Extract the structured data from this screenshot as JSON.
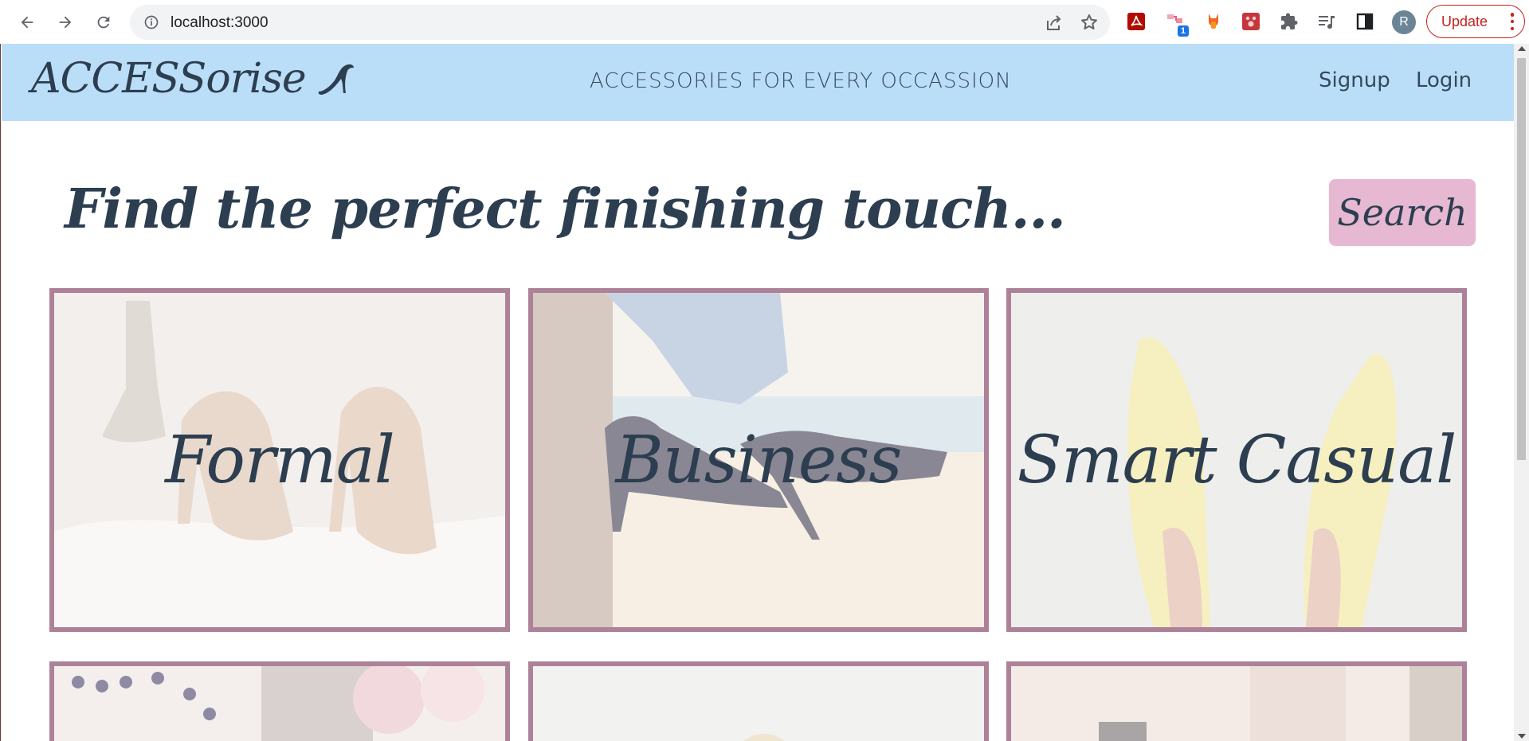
{
  "browser": {
    "url": "localhost:3000",
    "extension_badge": "1",
    "profile_initial": "R",
    "update_label": "Update"
  },
  "icons": {
    "back": "arrow-left",
    "forward": "arrow-right",
    "reload": "reload",
    "site_info": "info-circle",
    "share": "share",
    "bookmark": "star",
    "logo_icon": "high-heel-shoe",
    "extensions": [
      "pdf",
      "diagram",
      "fox",
      "paw",
      "puzzle",
      "media-queue",
      "side-panel"
    ]
  },
  "colors": {
    "header_bg": "#bbdef8",
    "text": "#2c3e50",
    "search_button_bg": "#e6b8d2",
    "card_border": "#ad8299",
    "update_red": "#c5221f"
  },
  "site": {
    "logo": "ACCESSorise",
    "tagline": "ACCESSORIES FOR EVERY OCCASSION",
    "nav": {
      "signup": "Signup",
      "login": "Login"
    },
    "hero_title": "Find the perfect finishing touch...",
    "search_label": "Search",
    "categories": [
      {
        "label": "Formal"
      },
      {
        "label": "Business"
      },
      {
        "label": "Smart Casual"
      },
      {
        "label": ""
      },
      {
        "label": ""
      },
      {
        "label": ""
      }
    ]
  }
}
